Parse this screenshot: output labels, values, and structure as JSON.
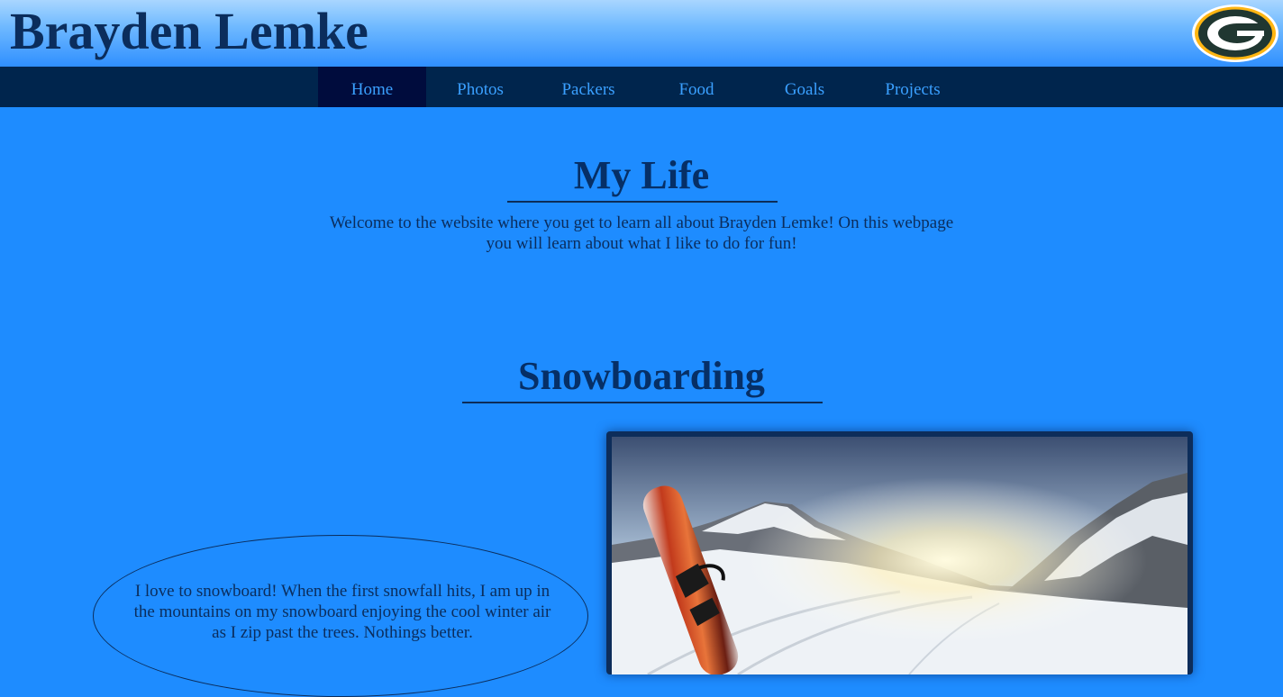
{
  "header": {
    "title": "Brayden Lemke",
    "logo_icon": "packers-g-logo-icon",
    "colors": {
      "logo_green": "#203731",
      "logo_gold": "#ffb612"
    }
  },
  "nav": {
    "items": [
      {
        "label": "Home",
        "active": true
      },
      {
        "label": "Photos"
      },
      {
        "label": "Packers"
      },
      {
        "label": "Food"
      },
      {
        "label": "Goals"
      },
      {
        "label": "Projects"
      }
    ]
  },
  "my_life": {
    "title": "My Life",
    "text": "Welcome to the website where you get to learn all about Brayden Lemke! On this webpage you will learn about what I like to do for fun!"
  },
  "snowboarding": {
    "title": "Snowboarding",
    "text": "I love to snowboard! When the first snowfall hits, I am up in the mountains on my snowboard enjoying the cool winter air as I zip past the trees. Nothings better.",
    "photo_icon": "snowboard-mountain-photo"
  },
  "colors": {
    "page_background": "#1e8cff",
    "nav_background": "#00254d",
    "nav_active": "#000c3d",
    "nav_text": "#3aa0ff",
    "heading": "#062f66"
  }
}
